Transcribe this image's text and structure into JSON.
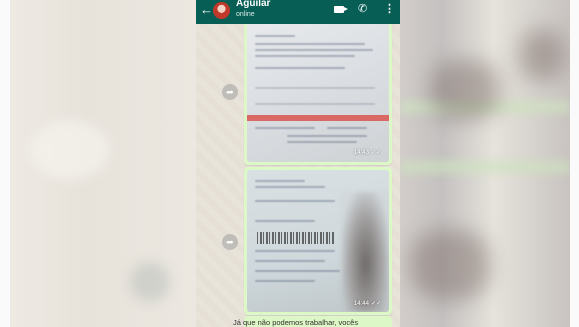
{
  "header": {
    "back_icon": "arrow-left-icon",
    "contact_name": "Aguilar",
    "status": "online",
    "video_icon": "video-call-icon",
    "call_icon": "phone-call-icon",
    "menu_icon": "more-vert-icon"
  },
  "messages": [
    {
      "type": "image",
      "time": "14:43",
      "status_icon": "double-check-icon"
    },
    {
      "type": "image",
      "time": "14:44",
      "status_icon": "double-check-icon"
    },
    {
      "type": "text",
      "text": "Já que não podemos trabalhar, vocês"
    }
  ],
  "colors": {
    "header": "#075e54",
    "outgoing_bubble": "#dcf8c6",
    "chat_background": "#e9e3d9"
  }
}
